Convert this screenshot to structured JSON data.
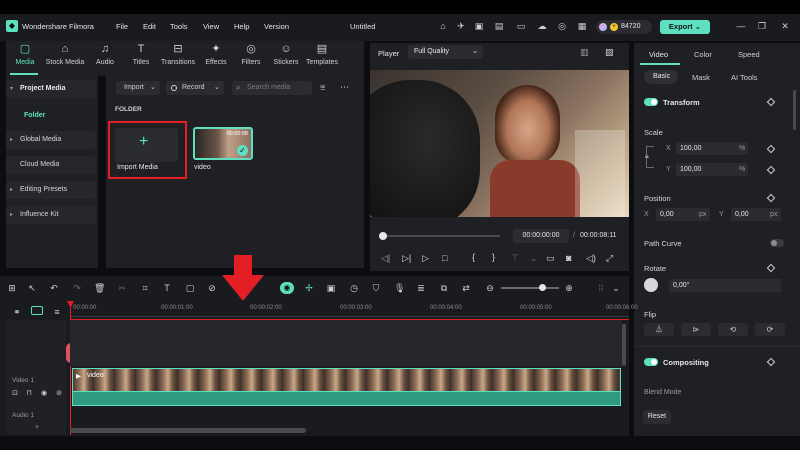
{
  "app": {
    "name": "Wondershare Filmora",
    "project_title": "Untitled"
  },
  "menu": [
    "File",
    "Edit",
    "Tools",
    "View",
    "Help",
    "Version"
  ],
  "credits": "84720",
  "export_label": "Export",
  "media_tabs": [
    "Media",
    "Stock Media",
    "Audio",
    "Titles",
    "Transitions",
    "Effects",
    "Filters",
    "Stickers",
    "Templates"
  ],
  "left_nav": {
    "project_media": "Project Media",
    "folder": "Folder",
    "global_media": "Global Media",
    "cloud_media": "Cloud Media",
    "editing_presets": "Editing Presets",
    "influence_kit": "Influence Kit"
  },
  "media_bin": {
    "import_label": "Import",
    "record_label": "Record",
    "search_placeholder": "Search media",
    "folder_heading": "FOLDER",
    "import_tile_label": "Import Media",
    "video_tile_label": "video",
    "video_duration": "00:00:08"
  },
  "player": {
    "label": "Player",
    "quality": "Full Quality",
    "current_time": "00:00:00:00",
    "separator": "/",
    "total_time": "00:00:08:11",
    "progress": 0.0
  },
  "props": {
    "tabs": [
      "Video",
      "Color",
      "Speed"
    ],
    "subtabs": [
      "Basic",
      "Mask",
      "AI Tools"
    ],
    "transform": "Transform",
    "scale": "Scale",
    "scale_x": "100,00",
    "scale_y": "100,00",
    "x_label": "X",
    "y_label": "Y",
    "percent": "%",
    "position": "Position",
    "pos_x": "0,00",
    "pos_y": "0,00",
    "px": "px",
    "path_curve": "Path Curve",
    "rotate": "Rotate",
    "rotate_value": "0,00°",
    "flip": "Flip",
    "compositing": "Compositing",
    "blend_mode": "Blend Mode",
    "reset": "Reset"
  },
  "timeline": {
    "ruler": [
      "00:00:00",
      "00:00:01:00",
      "00:00:02:00",
      "00:00:03:00",
      "00:00:04:00",
      "00:00:05:00",
      "00:00:06:00"
    ],
    "video_track": "Video 1",
    "audio_track": "Audio 1",
    "clip_label": "video"
  },
  "annotation_color": "#e31e24",
  "accent_color": "#5ee0c0"
}
